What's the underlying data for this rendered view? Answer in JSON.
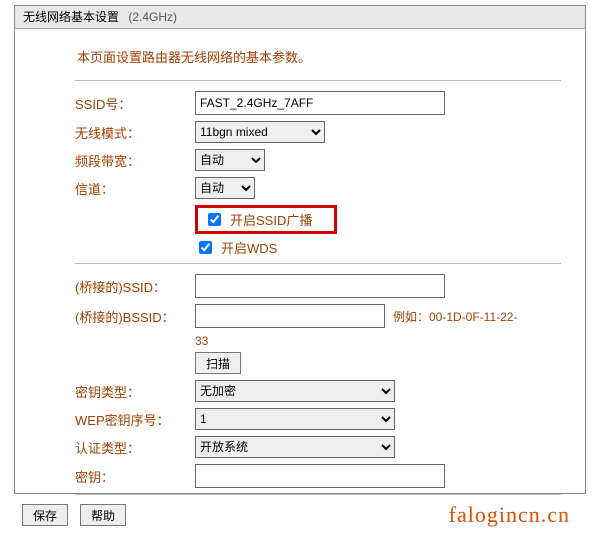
{
  "title": {
    "text": "无线网络基本设置",
    "band": "(2.4GHz)"
  },
  "intro": "本页面设置路由器无线网络的基本参数。",
  "labels": {
    "ssid": "SSID号：",
    "mode": "无线模式：",
    "bandwidth": "频段带宽：",
    "channel": "信道：",
    "bridge_ssid": "(桥接的)SSID：",
    "bridge_bssid": "(桥接的)BSSID：",
    "key_type": "密钥类型：",
    "wep_index": "WEP密钥序号：",
    "auth_type": "认证类型：",
    "key": "密钥："
  },
  "values": {
    "ssid": "FAST_2.4GHz_7AFF",
    "mode": "11bgn mixed",
    "bandwidth": "自动",
    "channel": "自动",
    "enable_ssid_broadcast_label": "开启SSID广播",
    "enable_ssid_broadcast": true,
    "enable_wds_label": "开启WDS",
    "enable_wds": true,
    "bridge_ssid": "",
    "bridge_bssid": "",
    "bssid_hint_prefix": "例如：00-1D-0F-11-22-",
    "bssid_hint_suffix": "33",
    "scan_btn": "扫描",
    "key_type": "无加密",
    "wep_index": "1",
    "auth_type": "开放系统",
    "key": ""
  },
  "buttons": {
    "save": "保存",
    "help": "帮助"
  },
  "watermark": "falogincn.cn"
}
